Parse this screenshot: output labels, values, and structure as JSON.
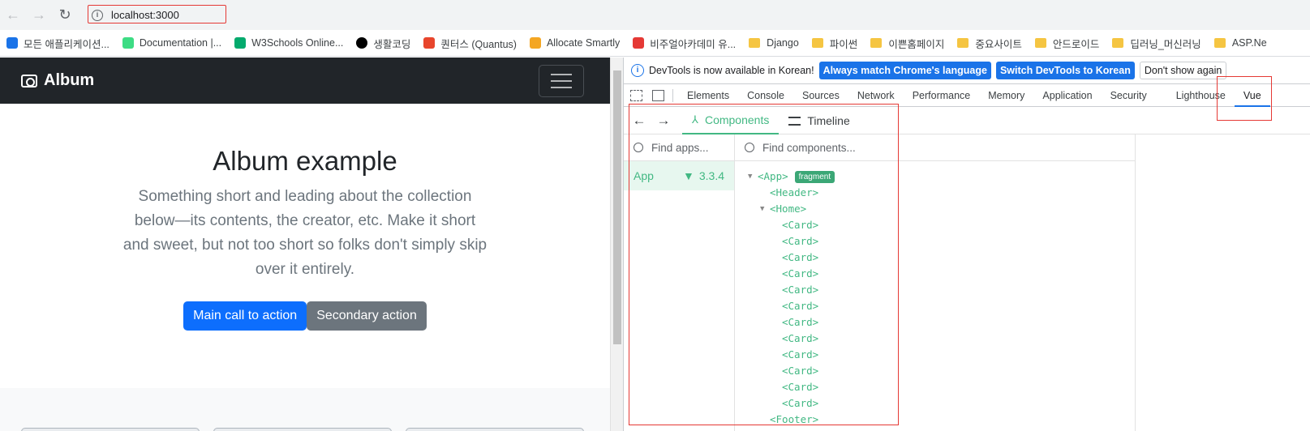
{
  "browser": {
    "url": "localhost:3000",
    "bookmarks": [
      {
        "label": "모든 애플리케이션...",
        "icon": "apps-icon"
      },
      {
        "label": "Documentation  |...",
        "icon": "android-icon"
      },
      {
        "label": "W3Schools Online...",
        "icon": "w3schools-icon"
      },
      {
        "label": "생활코딩",
        "icon": "dot-icon"
      },
      {
        "label": "퀀터스 (Quantus)",
        "icon": "quantus-icon"
      },
      {
        "label": "Allocate Smartly",
        "icon": "allocate-icon"
      },
      {
        "label": "비주얼아카데미 유...",
        "icon": "link-icon"
      },
      {
        "label": "Django",
        "icon": "folder-icon"
      },
      {
        "label": "파이썬",
        "icon": "folder-icon"
      },
      {
        "label": "이쁜홈페이지",
        "icon": "folder-icon"
      },
      {
        "label": "중요사이트",
        "icon": "folder-icon"
      },
      {
        "label": "안드로이드",
        "icon": "folder-icon"
      },
      {
        "label": "딥러닝_머신러닝",
        "icon": "folder-icon"
      },
      {
        "label": "ASP.Ne",
        "icon": "folder-icon"
      }
    ]
  },
  "page": {
    "brand": "Album",
    "hero_title": "Album example",
    "hero_lead": "Something short and leading about the collection below—its contents, the creator, etc. Make it short and sweet, but not too short so folks don't simply skip over it entirely.",
    "primary_btn": "Main call to action",
    "secondary_btn": "Secondary action"
  },
  "devtools": {
    "infobar_text": "DevTools is now available in Korean!",
    "btn_match": "Always match Chrome's language",
    "btn_switch": "Switch DevTools to Korean",
    "btn_dismiss": "Don't show again",
    "tabs": [
      "Elements",
      "Console",
      "Sources",
      "Network",
      "Performance",
      "Memory",
      "Application",
      "Security",
      "Lighthouse",
      "Vue"
    ],
    "vue": {
      "tab_components": "Components",
      "tab_timeline": "Timeline",
      "find_apps": "Find apps...",
      "find_components": "Find components...",
      "app_name": "App",
      "app_version": "3.3.4",
      "fragment_badge": "fragment",
      "tree": [
        {
          "label": "<App>",
          "depth": 0,
          "expand": true
        },
        {
          "label": "<Header>",
          "depth": 1,
          "expand": false
        },
        {
          "label": "<Home>",
          "depth": 1,
          "expand": true
        },
        {
          "label": "<Card>",
          "depth": 2,
          "expand": false
        },
        {
          "label": "<Card>",
          "depth": 2,
          "expand": false
        },
        {
          "label": "<Card>",
          "depth": 2,
          "expand": false
        },
        {
          "label": "<Card>",
          "depth": 2,
          "expand": false
        },
        {
          "label": "<Card>",
          "depth": 2,
          "expand": false
        },
        {
          "label": "<Card>",
          "depth": 2,
          "expand": false
        },
        {
          "label": "<Card>",
          "depth": 2,
          "expand": false
        },
        {
          "label": "<Card>",
          "depth": 2,
          "expand": false
        },
        {
          "label": "<Card>",
          "depth": 2,
          "expand": false
        },
        {
          "label": "<Card>",
          "depth": 2,
          "expand": false
        },
        {
          "label": "<Card>",
          "depth": 2,
          "expand": false
        },
        {
          "label": "<Card>",
          "depth": 2,
          "expand": false
        },
        {
          "label": "<Footer>",
          "depth": 1,
          "expand": false
        }
      ]
    }
  }
}
